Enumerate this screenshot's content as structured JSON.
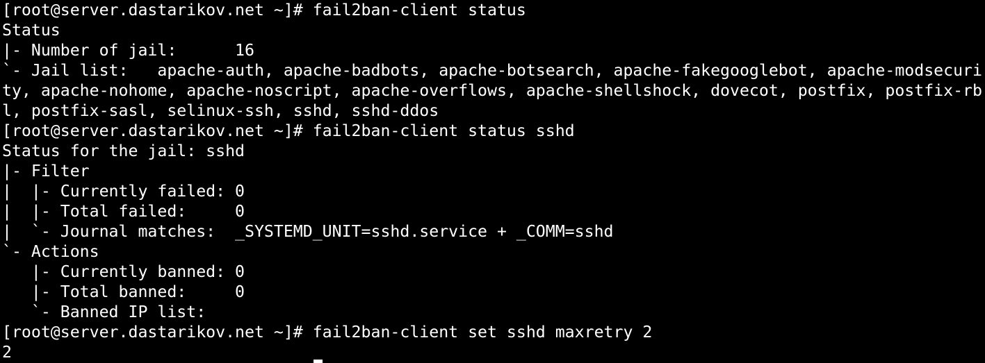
{
  "terminal": {
    "lines": [
      "[root@server.dastarikov.net ~]# fail2ban-client status",
      "Status",
      "|- Number of jail:      16",
      "`- Jail list:   apache-auth, apache-badbots, apache-botsearch, apache-fakegooglebot, apache-modsecuri",
      "ty, apache-nohome, apache-noscript, apache-overflows, apache-shellshock, dovecot, postfix, postfix-rb",
      "l, postfix-sasl, selinux-ssh, sshd, sshd-ddos",
      "[root@server.dastarikov.net ~]# fail2ban-client status sshd",
      "Status for the jail: sshd",
      "|- Filter",
      "|  |- Currently failed: 0",
      "|  |- Total failed:     0",
      "|  `- Journal matches:  _SYSTEMD_UNIT=sshd.service + _COMM=sshd",
      "`- Actions",
      "   |- Currently banned: 0",
      "   |- Total banned:     0",
      "   `- Banned IP list:",
      "[root@server.dastarikov.net ~]# fail2ban-client set sshd maxretry 2",
      "2"
    ],
    "colors": {
      "background": "#000000",
      "foreground": "#ffffff"
    }
  }
}
